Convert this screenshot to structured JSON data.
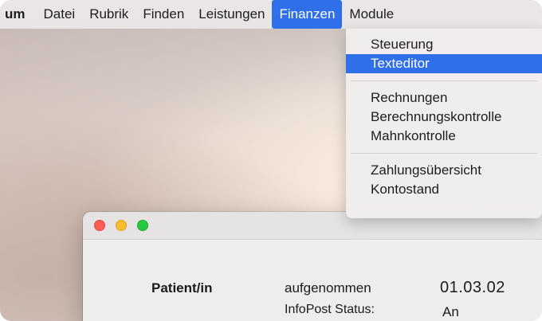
{
  "menubar": {
    "app_label": "um",
    "items": [
      "Datei",
      "Rubrik",
      "Finden",
      "Leistungen",
      "Finanzen",
      "Module"
    ],
    "active_item": "Finanzen"
  },
  "finanzen_menu": {
    "group1": [
      "Steuerung",
      "Texteditor"
    ],
    "selected_item": "Texteditor",
    "group2": [
      "Rechnungen",
      "Berechnungskontrolle",
      "Mahnkontrolle"
    ],
    "group3": [
      "Zahlungsübersicht",
      "Kontostand"
    ]
  },
  "window": {
    "patient_label": "Patient/in",
    "aufgenommen_label": "aufgenommen",
    "aufgenommen_value": "01.03.02",
    "infopost_label": "InfoPost Status:",
    "infopost_value": "An"
  },
  "colors": {
    "accent": "#2f6fea",
    "close": "#fc5e57",
    "minimize": "#febc2e",
    "zoom": "#28c840"
  }
}
